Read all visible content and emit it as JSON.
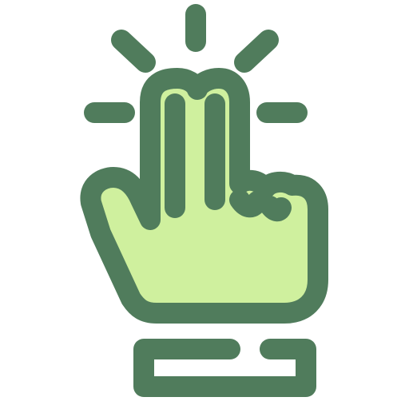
{
  "icon": {
    "name": "two-finger-tap-icon",
    "colors": {
      "outline": "#507C5C",
      "fill": "#CFF09E",
      "background": "#FFFFFF"
    }
  }
}
